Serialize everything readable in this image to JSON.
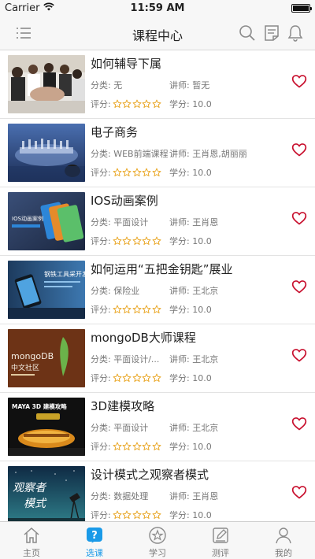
{
  "status_bar": {
    "carrier": "Carrier",
    "time": "11:59 AM"
  },
  "nav": {
    "title": "课程中心",
    "menu_icon": "menu-icon",
    "search_icon": "search-icon",
    "notes_icon": "notes-icon",
    "bell_icon": "bell-icon"
  },
  "labels": {
    "category": "分类:",
    "teacher": "讲师:",
    "rating": "评分:",
    "credit": "学分:"
  },
  "courses": [
    {
      "title": "如何辅导下属",
      "category": "无",
      "teacher": "暂无",
      "rating": 0,
      "credit": "10.0"
    },
    {
      "title": "电子商务",
      "category": "WEB前端课程",
      "teacher": "王肖恩,胡丽丽",
      "rating": 0,
      "credit": "10.0"
    },
    {
      "title": "IOS动画案例",
      "category": "平面设计",
      "teacher": "王肖恩",
      "rating": 0,
      "credit": "10.0"
    },
    {
      "title": "如何运用“五把金钥匙”展业",
      "category": "保险业",
      "teacher": "王北京",
      "rating": 0,
      "credit": "10.0"
    },
    {
      "title": "mongoDB大师课程",
      "category": "平面设计/...",
      "teacher": "王北京",
      "rating": 0,
      "credit": "10.0"
    },
    {
      "title": "3D建模攻略",
      "category": "平面设计",
      "teacher": "王北京",
      "rating": 0,
      "credit": "10.0"
    },
    {
      "title": "设计模式之观察者模式",
      "category": "数据处理",
      "teacher": "王肖恩",
      "rating": 0,
      "credit": "10.0"
    }
  ],
  "thumbs": {
    "t2_text": "IOS动画案例",
    "t3_text": "钢铁工具采开发",
    "t4_logo": "mongoDB",
    "t4_sub": "中文社区",
    "t5_text": "MAYA 3D 建模攻略",
    "t6_line1": "观察者",
    "t6_line2": "模式"
  },
  "tabs": [
    {
      "label": "主页",
      "icon": "home-icon",
      "active": false
    },
    {
      "label": "选课",
      "icon": "question-icon",
      "active": true
    },
    {
      "label": "学习",
      "icon": "star-badge-icon",
      "active": false
    },
    {
      "label": "测评",
      "icon": "edit-icon",
      "active": false
    },
    {
      "label": "我的",
      "icon": "user-icon",
      "active": false
    }
  ],
  "colors": {
    "accent": "#1a9ae8",
    "heart": "#c8102e",
    "star": "#e8a21a"
  }
}
